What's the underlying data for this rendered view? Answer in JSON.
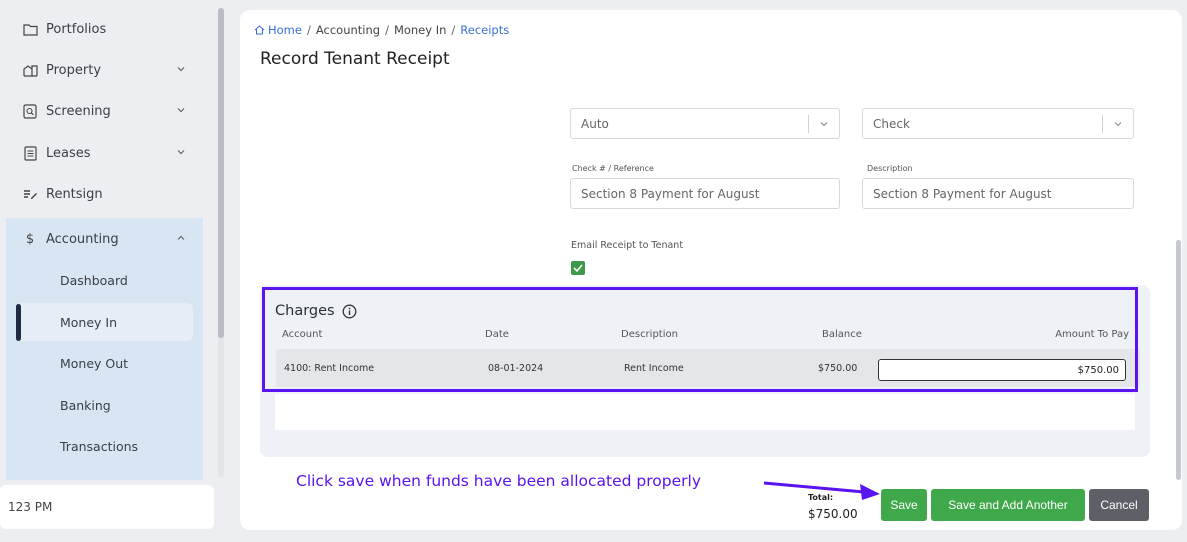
{
  "sidebar": {
    "items": [
      {
        "label": "Portfolios"
      },
      {
        "label": "Property"
      },
      {
        "label": "Screening"
      },
      {
        "label": "Leases"
      },
      {
        "label": "Rentsign"
      },
      {
        "label": "Accounting"
      }
    ],
    "accounting_sub": [
      {
        "label": "Dashboard"
      },
      {
        "label": "Money In"
      },
      {
        "label": "Money Out"
      },
      {
        "label": "Banking"
      },
      {
        "label": "Transactions"
      }
    ],
    "time": "123 PM"
  },
  "breadcrumb": {
    "home": "Home",
    "accounting": "Accounting",
    "money_in": "Money In",
    "receipts": "Receipts",
    "separator": "/"
  },
  "page_title": "Record Tenant Receipt",
  "form": {
    "select_left_value": "Auto",
    "select_right_value": "Check",
    "check_label": "Check # / Reference",
    "check_value": "Section 8 Payment for August",
    "description_label": "Description",
    "description_value": "Section 8 Payment for August",
    "email_label": "Email Receipt to Tenant",
    "email_checked": true
  },
  "charges": {
    "title": "Charges",
    "columns": [
      "Account",
      "Date",
      "Description",
      "Balance",
      "Amount To Pay"
    ],
    "rows": [
      {
        "account": "4100: Rent Income",
        "date": "08-01-2024",
        "description": "Rent Income",
        "balance": "$750.00",
        "amount": "$750.00"
      }
    ]
  },
  "annotation": "Click save when funds have been allocated properly",
  "footer": {
    "total_label": "Total:",
    "total_value": "$750.00",
    "save": "Save",
    "save_add": "Save and Add Another",
    "cancel": "Cancel"
  },
  "colors": {
    "accent": "#3a6fd8",
    "highlight": "#5a14f0",
    "success": "#3fa84a",
    "cancel": "#5d6066",
    "sidebar_active": "#d8e6f3"
  }
}
